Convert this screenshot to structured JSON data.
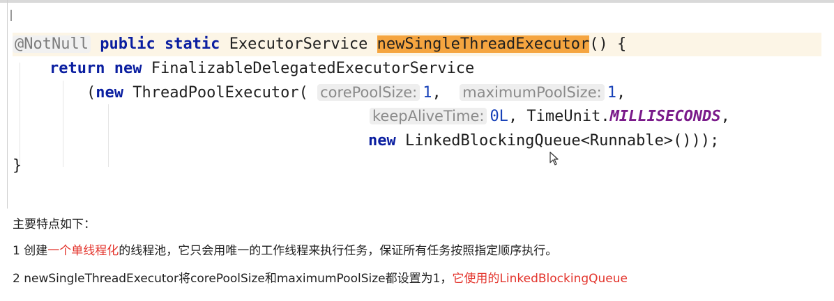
{
  "code": {
    "annotation": "@NotNull",
    "kw_public": "public",
    "kw_static": "static",
    "return_type": "ExecutorService",
    "method_name": "newSingleThreadExecutor",
    "sig_tail": "() {",
    "kw_return": "return",
    "kw_new": "new",
    "wrapper_class": "FinalizableDelegatedExecutorService",
    "line3_open": "(",
    "line3_ctor": "ThreadPoolExecutor(",
    "hint_core": "corePoolSize:",
    "core_val": "1",
    "comma1": ", ",
    "hint_max": "maximumPoolSize:",
    "max_val": "1",
    "comma2": ",",
    "hint_keep": "keepAliveTime:",
    "keep_val": "0L",
    "timeunit_prefix": ", TimeUnit.",
    "timeunit_const": "MILLISECONDS",
    "comma3": ",",
    "queue_expr": "LinkedBlockingQueue<Runnable>()));",
    "close_brace": "}"
  },
  "notes": {
    "heading": "主要特点如下：",
    "item1": {
      "prefix": "1 创建",
      "highlight": "一个单线程化",
      "rest": "的线程池，它只会用唯一的工作线程来执行任务，保证所有任务按照指定顺序执行。"
    },
    "item2": {
      "text": "2 newSingleThreadExecutor将corePoolSize和maximumPoolSize都设置为1，",
      "highlight": "它使用的LinkedBlockingQueue"
    }
  },
  "colors": {
    "selection": "#f5a540",
    "current_line": "#fcf5e6",
    "keyword": "#0a1ea0",
    "number": "#1741b8",
    "constant": "#7a1a8a",
    "note_red": "#e3332b"
  },
  "icons": {
    "mouse_pointer": "arrow-cursor-icon"
  }
}
